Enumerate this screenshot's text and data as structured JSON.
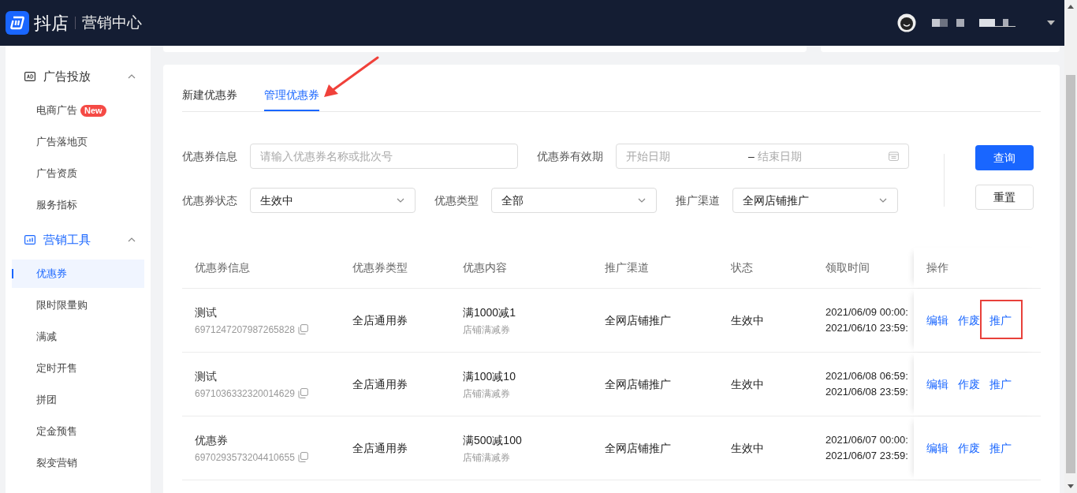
{
  "header": {
    "brand": "抖店",
    "product": "营销中心"
  },
  "sidebar": {
    "groups": [
      {
        "label": "广告投放",
        "kind": "ad",
        "active": false,
        "expanded": true,
        "children": [
          {
            "label": "电商广告",
            "badge": "New",
            "selected": false
          },
          {
            "label": "广告落地页",
            "selected": false
          },
          {
            "label": "广告资质",
            "selected": false
          },
          {
            "label": "服务指标",
            "selected": false
          }
        ]
      },
      {
        "label": "营销工具",
        "kind": "chart",
        "active": true,
        "expanded": true,
        "children": [
          {
            "label": "优惠券",
            "selected": true
          },
          {
            "label": "限时限量购",
            "selected": false
          },
          {
            "label": "满减",
            "selected": false
          },
          {
            "label": "定时开售",
            "selected": false
          },
          {
            "label": "拼团",
            "selected": false
          },
          {
            "label": "定金预售",
            "selected": false
          },
          {
            "label": "裂变营销",
            "selected": false
          }
        ]
      }
    ]
  },
  "tabs": [
    {
      "label": "新建优惠券",
      "selected": false,
      "annotated": false
    },
    {
      "label": "管理优惠券",
      "selected": true,
      "annotated": true
    }
  ],
  "filters": [
    {
      "kind": "text",
      "label": "优惠券信息",
      "placeholder": "请输入优惠券名称或批次号"
    },
    {
      "kind": "daterange",
      "label": "优惠券有效期",
      "start_placeholder": "开始日期",
      "separator": "–",
      "end_placeholder": "结束日期"
    },
    {
      "kind": "select",
      "label": "优惠券状态",
      "value": "生效中"
    },
    {
      "kind": "select",
      "label": "优惠类型",
      "value": "全部"
    },
    {
      "kind": "select",
      "label": "推广渠道",
      "value": "全网店铺推广"
    }
  ],
  "buttons": {
    "query": "查询",
    "reset": "重置"
  },
  "table": {
    "columns": [
      "优惠券信息",
      "优惠券类型",
      "优惠内容",
      "推广渠道",
      "状态",
      "领取时间",
      "操作"
    ],
    "rows": [
      {
        "name": "测试",
        "batch_id": "6971247207987265828",
        "type": "全店通用券",
        "content": "满1000减1",
        "content_sub": "店铺满减券",
        "channel": "全网店铺推广",
        "status": "生效中",
        "time_start": "2021/06/09 00:00:",
        "time_end": "2021/06/10 23:59:",
        "actions": [
          {
            "label": "编辑",
            "highlighted": false
          },
          {
            "label": "作废",
            "highlighted": false
          },
          {
            "label": "推广",
            "highlighted": true
          }
        ]
      },
      {
        "name": "测试",
        "batch_id": "6971036332320014629",
        "type": "全店通用券",
        "content": "满100减10",
        "content_sub": "店铺满减券",
        "channel": "全网店铺推广",
        "status": "生效中",
        "time_start": "2021/06/08 06:59:",
        "time_end": "2021/06/08 23:59:",
        "actions": [
          {
            "label": "编辑",
            "highlighted": false
          },
          {
            "label": "作废",
            "highlighted": false
          },
          {
            "label": "推广",
            "highlighted": false
          }
        ]
      },
      {
        "name": "优惠券",
        "batch_id": "6970293573204410655",
        "type": "全店通用券",
        "content": "满500减100",
        "content_sub": "店铺满减券",
        "channel": "全网店铺推广",
        "status": "生效中",
        "time_start": "2021/06/07 00:00:",
        "time_end": "2021/06/07 23:59:",
        "actions": [
          {
            "label": "编辑",
            "highlighted": false
          },
          {
            "label": "作废",
            "highlighted": false
          },
          {
            "label": "推广",
            "highlighted": false
          }
        ]
      }
    ]
  }
}
